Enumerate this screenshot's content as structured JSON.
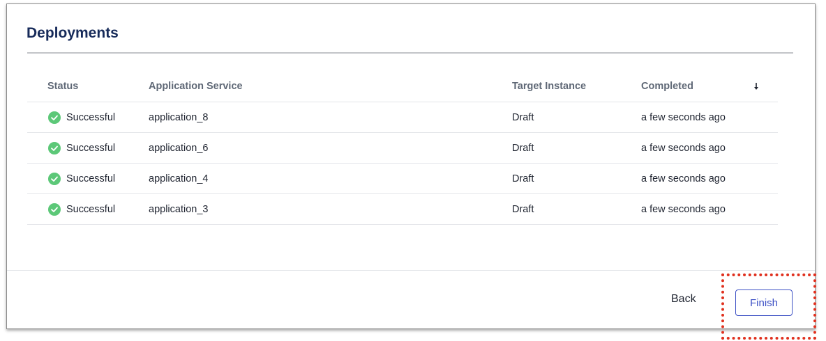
{
  "page": {
    "title": "Deployments"
  },
  "table": {
    "headers": {
      "status": "Status",
      "application_service": "Application Service",
      "target_instance": "Target Instance",
      "completed": "Completed"
    },
    "sort_icon": "arrow-down-icon",
    "rows": [
      {
        "status": "Successful",
        "application_service": "application_8",
        "target_instance": "Draft",
        "completed": "a few seconds ago"
      },
      {
        "status": "Successful",
        "application_service": "application_6",
        "target_instance": "Draft",
        "completed": "a few seconds ago"
      },
      {
        "status": "Successful",
        "application_service": "application_4",
        "target_instance": "Draft",
        "completed": "a few seconds ago"
      },
      {
        "status": "Successful",
        "application_service": "application_3",
        "target_instance": "Draft",
        "completed": "a few seconds ago"
      }
    ]
  },
  "footer": {
    "back_label": "Back",
    "finish_label": "Finish"
  },
  "colors": {
    "title": "#172b5a",
    "success": "#5cc878",
    "primary": "#3b4fc4",
    "highlight": "#e0301e"
  }
}
